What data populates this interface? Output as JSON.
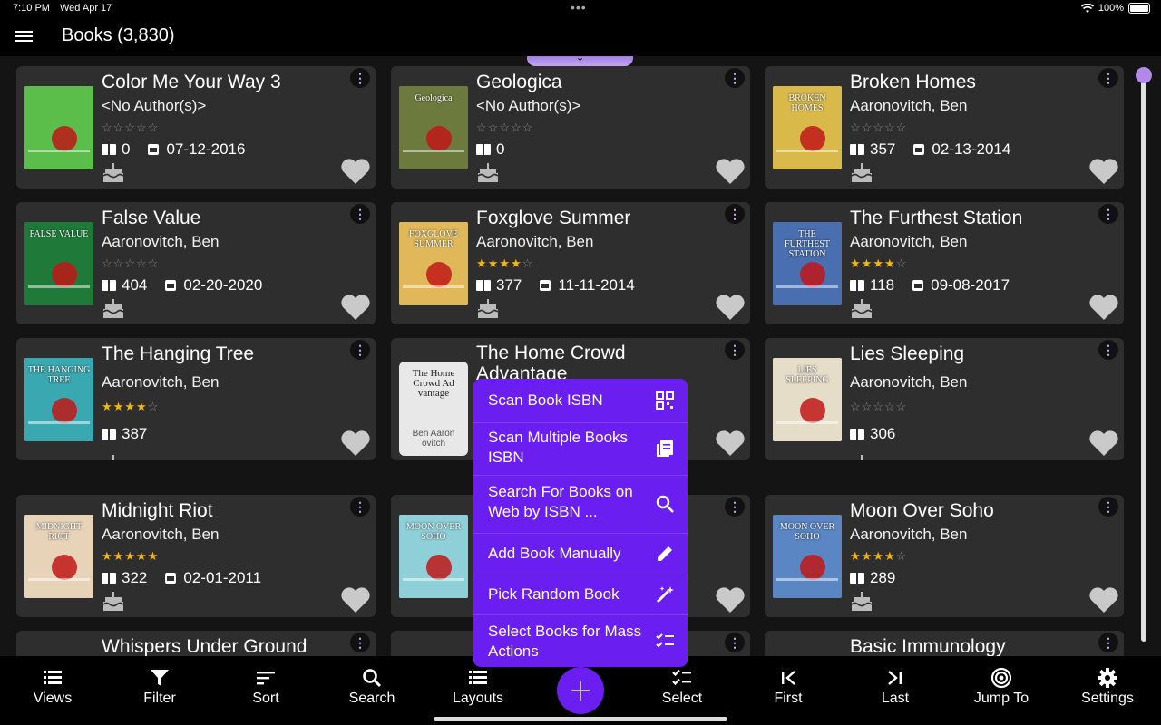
{
  "status": {
    "time": "7:10 PM",
    "date": "Wed Apr 17",
    "battery": "100%"
  },
  "header": {
    "title": "Books (3,830)"
  },
  "books": [
    {
      "title": "Color Me Your Way 3",
      "author": "<No Author(s)>",
      "rating": 0,
      "pages": "0",
      "date": "07-12-2016",
      "cover_text": "",
      "cover_color": "#5bbd4a"
    },
    {
      "title": "Geologica",
      "author": "<No Author(s)>",
      "rating": 0,
      "pages": "0",
      "date": "",
      "cover_text": "Geologica",
      "cover_color": "#6c7a3e"
    },
    {
      "title": "Broken Homes",
      "author": "Aaronovitch, Ben",
      "rating": 0,
      "pages": "357",
      "date": "02-13-2014",
      "cover_text": "BROKEN HOMES",
      "cover_color": "#d8b94a"
    },
    {
      "title": "False Value",
      "author": "Aaronovitch, Ben",
      "rating": 0,
      "pages": "404",
      "date": "02-20-2020",
      "cover_text": "FALSE VALUE",
      "cover_color": "#1f7a3a"
    },
    {
      "title": "Foxglove Summer",
      "author": "Aaronovitch, Ben",
      "rating": 4,
      "pages": "377",
      "date": "11-11-2014",
      "cover_text": "FOXGLOVE SUMMER",
      "cover_color": "#e0b85a"
    },
    {
      "title": "The Furthest Station",
      "author": "Aaronovitch, Ben",
      "rating": 4,
      "pages": "118",
      "date": "09-08-2017",
      "cover_text": "THE FURTHEST STATION",
      "cover_color": "#4a6fb0"
    },
    {
      "title": "The Hanging Tree",
      "author": "Aaronovitch, Ben",
      "rating": 4,
      "pages": "387",
      "date": "",
      "cover_text": "THE HANGING TREE",
      "cover_color": "#3aa8b0"
    },
    {
      "title": "The Home Crowd Advantage",
      "author": "",
      "rating": 0,
      "pages": "",
      "date": "",
      "cover_text": "The Home Crowd Ad vantage",
      "cover_sub": "Ben Aaron ovitch",
      "cover_color": "#e8e8e8"
    },
    {
      "title": "Lies Sleeping",
      "author": "Aaronovitch, Ben",
      "rating": 0,
      "pages": "306",
      "date": "",
      "cover_text": "LIES SLEEPING",
      "cover_color": "#e6ddc8"
    },
    {
      "title": "Midnight Riot",
      "author": "Aaronovitch, Ben",
      "rating": 5,
      "pages": "322",
      "date": "02-01-2011",
      "cover_text": "MIDNIGHT RIOT",
      "cover_color": "#e6d3b8"
    },
    {
      "title": "",
      "author": "",
      "rating": 0,
      "pages": "",
      "date": "",
      "cover_text": "MOON OVER SOHO",
      "cover_color": "#8fd0d8"
    },
    {
      "title": "Moon Over Soho",
      "author": "Aaronovitch, Ben",
      "rating": 4,
      "pages": "289",
      "date": "",
      "cover_text": "MOON OVER SOHO",
      "cover_color": "#5a86c4"
    },
    {
      "title": "Whispers Under Ground",
      "author": "",
      "rating": 0,
      "pages": "",
      "date": "",
      "cover_text": "",
      "cover_color": "#2e2e2e"
    },
    {
      "title": "",
      "author": "",
      "rating": 0,
      "pages": "",
      "date": "",
      "cover_text": "",
      "cover_color": "#2e2e2e"
    },
    {
      "title": "Basic Immunology",
      "author": "",
      "rating": 0,
      "pages": "",
      "date": "",
      "cover_text": "",
      "cover_color": "#2e2e2e"
    }
  ],
  "fab_menu": [
    {
      "label": "Scan Book ISBN",
      "icon": "qr-scan-icon"
    },
    {
      "label": "Scan Multiple Books ISBN",
      "icon": "library-books-icon"
    },
    {
      "label": "Search For Books on Web by ISBN ...",
      "icon": "search-icon"
    },
    {
      "label": "Add Book Manually",
      "icon": "pencil-icon"
    },
    {
      "label": "Pick Random Book",
      "icon": "magic-wand-icon"
    },
    {
      "label": "Select Books for Mass Actions",
      "icon": "checklist-icon"
    }
  ],
  "bottom_nav": [
    {
      "label": "Views",
      "icon": "views-icon"
    },
    {
      "label": "Filter",
      "icon": "filter-icon"
    },
    {
      "label": "Sort",
      "icon": "sort-icon"
    },
    {
      "label": "Search",
      "icon": "search-icon"
    },
    {
      "label": "Layouts",
      "icon": "layouts-icon"
    },
    {
      "label": "Select",
      "icon": "select-icon"
    },
    {
      "label": "First",
      "icon": "first-icon"
    },
    {
      "label": "Last",
      "icon": "last-icon"
    },
    {
      "label": "Jump To",
      "icon": "target-icon"
    },
    {
      "label": "Settings",
      "icon": "gear-icon"
    }
  ],
  "colors": {
    "accent": "#6a1ff0",
    "card": "#2e2e2e",
    "star": "#f5b800"
  }
}
